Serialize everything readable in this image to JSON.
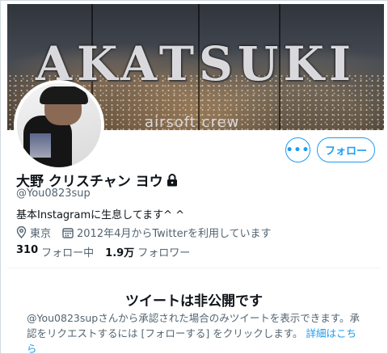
{
  "banner": {
    "title": "AKATSUKI",
    "subtitle": "airsoft crew"
  },
  "actions": {
    "more_label": "•••",
    "follow_label": "フォロー"
  },
  "profile": {
    "display_name": "大野 クリスチャン ヨウ",
    "handle": "@You0823sup",
    "bio": "基本Instagramに生息してます^ ^",
    "location": "東京",
    "joined": "2012年4月からTwitterを利用しています"
  },
  "stats": {
    "following_count": "310",
    "following_label": "フォロー中",
    "followers_count": "1.9万",
    "followers_label": "フォロワー"
  },
  "private_notice": {
    "title": "ツイートは非公開です",
    "description": "@You0823supさんから承認された場合のみツイートを表示できます。承認をリクエストするには [フォローする] をクリックします。",
    "link_label": "詳細はこちら"
  },
  "colors": {
    "accent": "#1d9bf0",
    "text_primary": "#0f1419",
    "text_secondary": "#536471"
  },
  "icons": [
    "lock-icon",
    "location-pin-icon",
    "calendar-icon",
    "more-dots-icon"
  ]
}
